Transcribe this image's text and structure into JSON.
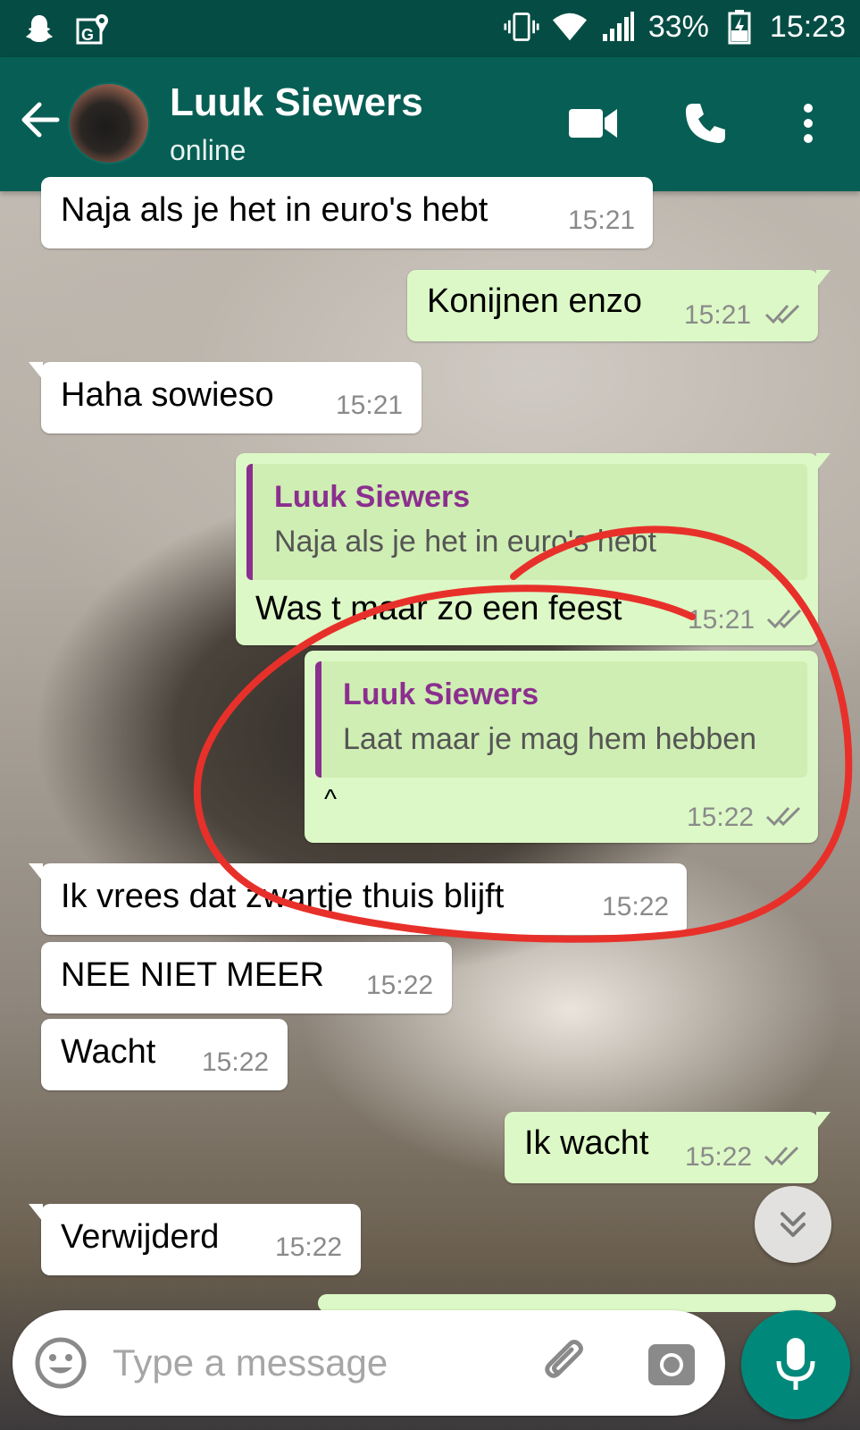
{
  "status_bar": {
    "battery": "33%",
    "time": "15:23",
    "icons": [
      "snapchat-icon",
      "google-maps-icon",
      "vibrate-icon",
      "wifi-icon",
      "signal-icon",
      "battery-charging-icon"
    ]
  },
  "header": {
    "contact_name": "Luuk Siewers",
    "contact_status": "online",
    "icons": [
      "back-arrow-icon",
      "video-call-icon",
      "phone-call-icon",
      "more-options-icon"
    ]
  },
  "messages": [
    {
      "direction": "in",
      "text": "Naja als je het in euro's hebt",
      "time": "15:21"
    },
    {
      "direction": "out",
      "text": "Konijnen enzo",
      "time": "15:21",
      "read": true
    },
    {
      "direction": "in",
      "text": "Haha sowieso",
      "time": "15:21"
    },
    {
      "direction": "out",
      "quote_name": "Luuk Siewers",
      "quote_text": "Naja als je het in euro's hebt",
      "text": "Was t maar zo een feest",
      "time": "15:21",
      "read": true
    },
    {
      "direction": "out",
      "quote_name": "Luuk Siewers",
      "quote_text": "Laat maar je mag hem hebben",
      "text": "^",
      "time": "15:22",
      "read": true
    },
    {
      "direction": "in",
      "text": "Ik vrees dat zwartje thuis blijft",
      "time": "15:22"
    },
    {
      "direction": "in",
      "text": "NEE NIET MEER",
      "time": "15:22"
    },
    {
      "direction": "in",
      "text": "Wacht",
      "time": "15:22"
    },
    {
      "direction": "out",
      "text": "Ik wacht",
      "time": "15:22",
      "read": true
    },
    {
      "direction": "in",
      "text": "Verwijderd",
      "time": "15:22"
    }
  ],
  "composer": {
    "placeholder": "Type a message",
    "icons": [
      "emoji-icon",
      "attach-icon",
      "camera-icon",
      "mic-icon"
    ]
  },
  "colors": {
    "status_bar": "#054d44",
    "header": "#075e54",
    "outgoing_bubble": "#dcf8c6",
    "incoming_bubble": "#ffffff",
    "quote_accent": "#8b2f8f",
    "read_ticks": "#8a8a8a",
    "mic_button": "#00897b",
    "annotation_stroke": "#e8302a"
  }
}
